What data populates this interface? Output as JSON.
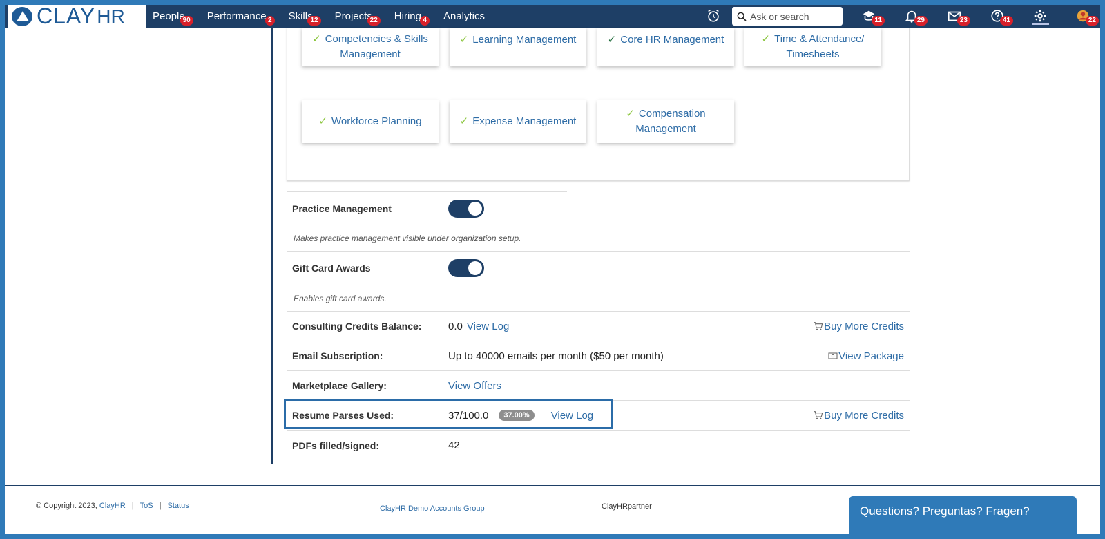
{
  "brand": {
    "name_clay": "CLAY",
    "name_hr": "HR"
  },
  "nav": [
    {
      "label": "People",
      "badge": "90"
    },
    {
      "label": "Performance",
      "badge": "2"
    },
    {
      "label": "Skills",
      "badge": "12"
    },
    {
      "label": "Projects",
      "badge": "22"
    },
    {
      "label": "Hiring",
      "badge": "4"
    },
    {
      "label": "Analytics",
      "badge": ""
    }
  ],
  "search": {
    "placeholder": "Ask or search"
  },
  "header_icons": {
    "learning_badge": "11",
    "notifications_badge": "29",
    "messages_badge": "23",
    "help_badge": "41",
    "profile_badge": "22"
  },
  "modules": [
    {
      "label": "Competencies & Skills Management"
    },
    {
      "label": "Learning Management"
    },
    {
      "label": "Core HR Management"
    },
    {
      "label": "Time & Attendance/ Timesheets"
    },
    {
      "label": "Workforce Planning"
    },
    {
      "label": "Expense Management"
    },
    {
      "label": "Compensation Management"
    }
  ],
  "settings": {
    "practice_label": "Practice Management",
    "practice_desc": "Makes practice management visible under organization setup.",
    "practice_on": true,
    "giftcard_label": "Gift Card Awards",
    "giftcard_desc": "Enables gift card awards.",
    "giftcard_on": true,
    "consulting_label": "Consulting Credits Balance:",
    "consulting_value": "0.0",
    "consulting_link": "View Log",
    "consulting_buy": "Buy More Credits",
    "email_label": "Email Subscription:",
    "email_value": "Up to 40000 emails per month ($50 per month)",
    "email_link": "View Package",
    "marketplace_label": "Marketplace Gallery:",
    "marketplace_link": "View Offers",
    "resume_label": "Resume Parses Used:",
    "resume_value": "37/100.0",
    "resume_pct": "37.00%",
    "resume_link": "View Log",
    "resume_buy": "Buy More Credits",
    "pdf_label": "PDFs filled/signed:",
    "pdf_value": "42"
  },
  "footer": {
    "copyright": "© Copyright 2023,",
    "company": "ClayHR",
    "tos": "ToS",
    "status": "Status",
    "group": "ClayHR Demo Accounts Group",
    "partner": "ClayHRpartner",
    "help": "Questions? Preguntas? Fragen?"
  },
  "colors": {
    "nav_bg": "#1e3f66",
    "accent": "#2e6ca6",
    "badge": "#d7202a",
    "check": "#8cc63f"
  }
}
